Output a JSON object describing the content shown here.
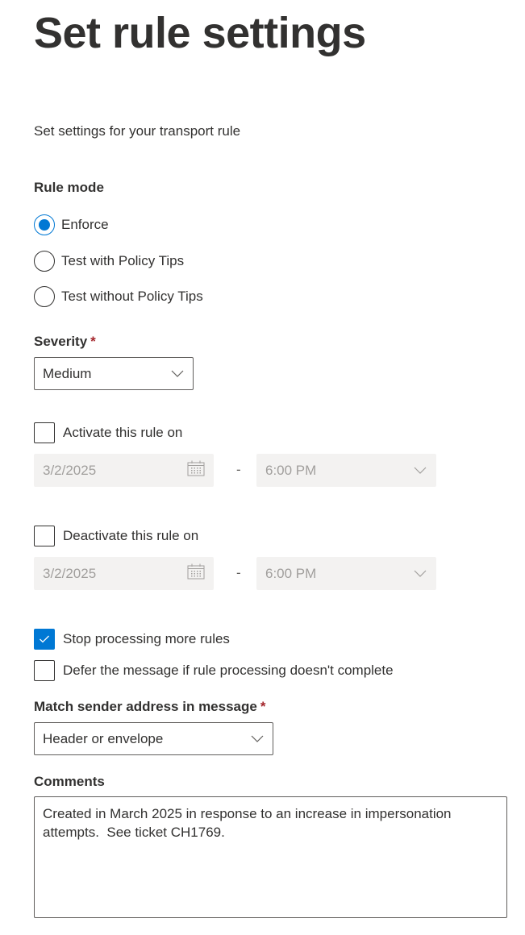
{
  "page": {
    "title": "Set rule settings",
    "subtitle": "Set settings for your transport rule"
  },
  "rule_mode": {
    "label": "Rule mode",
    "options": [
      {
        "label": "Enforce",
        "selected": true
      },
      {
        "label": "Test with Policy Tips",
        "selected": false
      },
      {
        "label": "Test without Policy Tips",
        "selected": false
      }
    ]
  },
  "severity": {
    "label": "Severity",
    "required_marker": "*",
    "value": "Medium",
    "icon": "chevron-down-icon"
  },
  "activate": {
    "label": "Activate this rule on",
    "checked": false,
    "date": "3/2/2025",
    "date_icon": "calendar-icon",
    "separator": "-",
    "time": "6:00 PM",
    "time_icon": "chevron-down-icon"
  },
  "deactivate": {
    "label": "Deactivate this rule on",
    "checked": false,
    "date": "3/2/2025",
    "date_icon": "calendar-icon",
    "separator": "-",
    "time": "6:00 PM",
    "time_icon": "chevron-down-icon"
  },
  "options": {
    "stop_processing": {
      "label": "Stop processing more rules",
      "checked": true
    },
    "defer_message": {
      "label": "Defer the message if rule processing doesn't complete",
      "checked": false
    }
  },
  "match_sender": {
    "label": "Match sender address in message",
    "required_marker": "*",
    "value": "Header or envelope",
    "icon": "chevron-down-icon"
  },
  "comments": {
    "label": "Comments",
    "value": "Created in March 2025 in response to an increase in impersonation attempts.  See ticket CH1769."
  },
  "colors": {
    "accent": "#0078d4",
    "required": "#a4262c",
    "text": "#323130",
    "disabled_bg": "#f3f2f1",
    "disabled_text": "#a19f9d"
  }
}
